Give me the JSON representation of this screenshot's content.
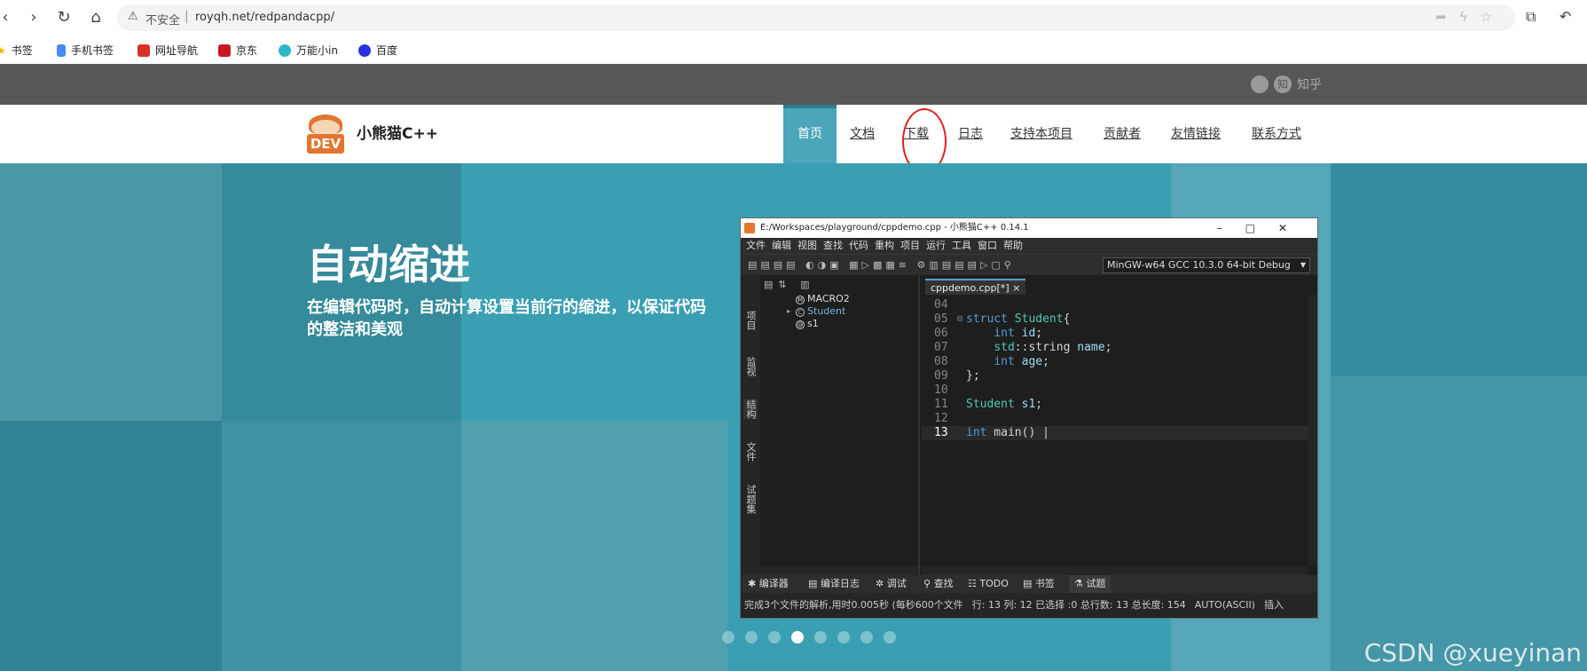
{
  "browser": {
    "url_warning": "不安全",
    "url": "royqh.net/redpandacpp/",
    "bookmarks": [
      "书签",
      "手机书签",
      "网址导航",
      "京东",
      "万能小in",
      "百度"
    ]
  },
  "site": {
    "links": [
      "知乎"
    ],
    "brand": "小熊猫C++",
    "logo_text": "DEV",
    "nav": [
      "首页",
      "文档",
      "下载",
      "日志",
      "支持本项目",
      "贡献者",
      "友情链接",
      "联系方式"
    ],
    "active_nav": "首页"
  },
  "hero": {
    "title": "自动缩进",
    "subtitle": "在编辑代码时，自动计算设置当前行的缩进，以保证代码的整洁和美观",
    "slide_count": 8,
    "active_slide": 4,
    "watermark": "CSDN @xueyinan"
  },
  "ide": {
    "title": "E:/Workspaces/playground/cppdemo.cpp - 小熊猫C++ 0.14.1",
    "menu": [
      "文件",
      "编辑",
      "视图",
      "查找",
      "代码",
      "重构",
      "项目",
      "运行",
      "工具",
      "窗口",
      "帮助"
    ],
    "compiler": "MinGW-w64 GCC 10.3.0 64-bit Debug",
    "side_tabs": [
      "项目",
      "监视",
      "结构",
      "文件",
      "试题集"
    ],
    "tree": [
      {
        "label": "MACRO2",
        "icon": "M"
      },
      {
        "label": "Student",
        "icon": "C"
      },
      {
        "label": "s1",
        "icon": "@"
      }
    ],
    "editor_tab": "cppdemo.cpp[*] ×",
    "code_lines": [
      {
        "num": "04",
        "text": ""
      },
      {
        "num": "05",
        "text": "struct Student{"
      },
      {
        "num": "06",
        "text": "    int id;"
      },
      {
        "num": "07",
        "text": "    std::string name;"
      },
      {
        "num": "08",
        "text": "    int age;"
      },
      {
        "num": "09",
        "text": "};"
      },
      {
        "num": "10",
        "text": ""
      },
      {
        "num": "11",
        "text": "Student s1;"
      },
      {
        "num": "12",
        "text": ""
      },
      {
        "num": "13",
        "text": "int main() |"
      }
    ],
    "current_line": "13",
    "bottom_tabs": [
      "编译器",
      "编译日志",
      "调试",
      "查找",
      "TODO",
      "书签",
      "试题"
    ],
    "status": {
      "parse": "完成3个文件的解析,用时0.005秒 (每秒600个文件",
      "position": "行: 13 列: 12 已选择 :0 总行数: 13 总长度: 154",
      "encoding": "AUTO(ASCII)",
      "mode": "插入"
    }
  }
}
